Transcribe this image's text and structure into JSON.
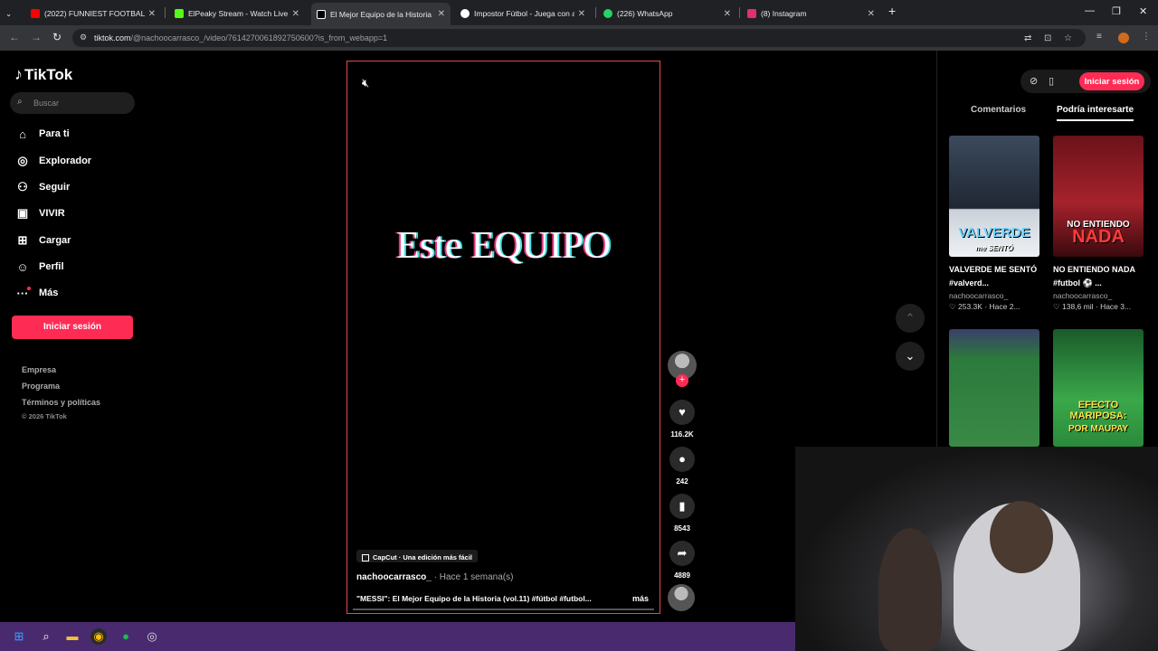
{
  "browser": {
    "tabs": [
      {
        "title": "(2022) FUNNIEST FOOTBALL M...",
        "active": false,
        "favicon_color": "#ff0000"
      },
      {
        "title": "ElPeaky Stream - Watch Live on...",
        "active": false,
        "favicon_color": "#53fc18"
      },
      {
        "title": "El Mejor Equipo de la Historia (...",
        "active": true,
        "favicon_color": "#000000"
      },
      {
        "title": "Impostor Fútbol - Juega con ar...",
        "active": false,
        "favicon_color": "#ffffff"
      },
      {
        "title": "(226) WhatsApp",
        "active": false,
        "favicon_color": "#25d366"
      },
      {
        "title": "(8) Instagram",
        "active": false,
        "favicon_color": "#e1306c"
      }
    ],
    "new_tab_icon": "+",
    "url": {
      "domain": "tiktok.com",
      "path": "/@nachoocarrasco_/video/7614270061892750600?is_from_webapp=1"
    }
  },
  "sidebar": {
    "logo_text": "TikTok",
    "search_placeholder": "Buscar",
    "nav": [
      {
        "label": "Para ti",
        "icon": "home-icon"
      },
      {
        "label": "Explorador",
        "icon": "compass-icon"
      },
      {
        "label": "Seguir",
        "icon": "follow-icon"
      },
      {
        "label": "VIVIR",
        "icon": "live-icon"
      },
      {
        "label": "Cargar",
        "icon": "upload-icon"
      },
      {
        "label": "Perfil",
        "icon": "profile-icon"
      },
      {
        "label": "Más",
        "icon": "more-icon"
      }
    ],
    "login_label": "Iniciar sesión",
    "footer_links": [
      "Empresa",
      "Programa",
      "Términos y políticas"
    ],
    "copyright": "© 2026 TikTok"
  },
  "video": {
    "overlay_text": "Este EQUIPO",
    "capcut_label": "CapCut · Una edición más fácil",
    "author": "nachoocarrasco_",
    "posted": "· Hace 1 semana(s)",
    "caption": "\"MESSI\": El Mejor Equipo de la Historia (vol.11) #fútbol #futbol...",
    "more_label": "más"
  },
  "actions": {
    "likes": "116.2K",
    "comments": "242",
    "saves": "8543",
    "shares": "4889"
  },
  "right_panel": {
    "login_label": "Iniciar sesión",
    "tabs": [
      "Comentarios",
      "Podría interesarte"
    ],
    "active_tab": "Podría interesarte",
    "cards": [
      {
        "thumb_text": "VALVERDE",
        "thumb_subtext": "me SENTÓ",
        "title": "VALVERDE ME SENTÓ #valverd...",
        "author": "nachoocarrasco_",
        "likes": "253.3K",
        "ago": "Hace 2...",
        "bg": "#2f3a4a"
      },
      {
        "thumb_text": "NO ENTIENDO",
        "thumb_subtext": "NADA",
        "title": "NO ENTIENDO NADA #futbol ⚽ ...",
        "author": "nachoocarrasco_",
        "likes": "138,6 mil",
        "ago": "Hace 3...",
        "bg": "#8a1a22"
      },
      {
        "thumb_text": "",
        "thumb_subtext": "",
        "title": "",
        "author": "",
        "likes": "",
        "ago": "",
        "bg": "#2f6a3a"
      },
      {
        "thumb_text": "EFECTO MARIPOSA:",
        "thumb_subtext": "POR MAUPAY",
        "title": "",
        "author": "",
        "likes": "",
        "ago": "",
        "bg": "#3aa84a"
      }
    ]
  },
  "colors": {
    "accent": "#fe2c55",
    "video_border": "#e34a4a",
    "taskbar": "#4a2a6e"
  }
}
